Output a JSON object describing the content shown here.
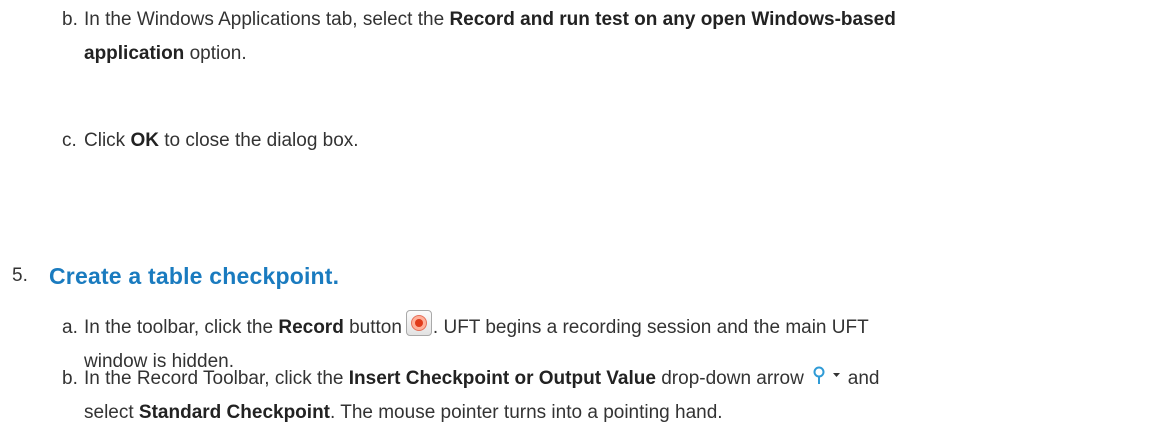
{
  "step4": {
    "b": {
      "marker": "b.",
      "text1": "In the Windows Applications tab, select the ",
      "bold1": "Record and run test on any open Windows-based",
      "bold2": "application",
      "text2": " option."
    },
    "c": {
      "marker": "c.",
      "text1": "Click ",
      "bold1": "OK",
      "text2": " to close the dialog box."
    }
  },
  "step5": {
    "number": "5.",
    "title": "Create a table checkpoint.",
    "a": {
      "marker": "a.",
      "text1": "In the toolbar, click the ",
      "bold1": "Record",
      "text2": " button",
      "text3": ". UFT begins a recording session and the main UFT",
      "text4": "window is hidden."
    },
    "b": {
      "marker": "b.",
      "text1": "In the Record Toolbar, click the ",
      "bold1": "Insert Checkpoint or Output Value",
      "text2": " drop-down arrow",
      "text3": "and",
      "bold2": "Standard Checkpoint",
      "text4": "select ",
      "text5": ". The mouse pointer turns into a pointing hand."
    }
  },
  "icons": {
    "record": "record-icon",
    "checkpoint": "checkpoint-dropdown-icon"
  },
  "colors": {
    "heading": "#1a7bbf",
    "text": "#333333"
  }
}
